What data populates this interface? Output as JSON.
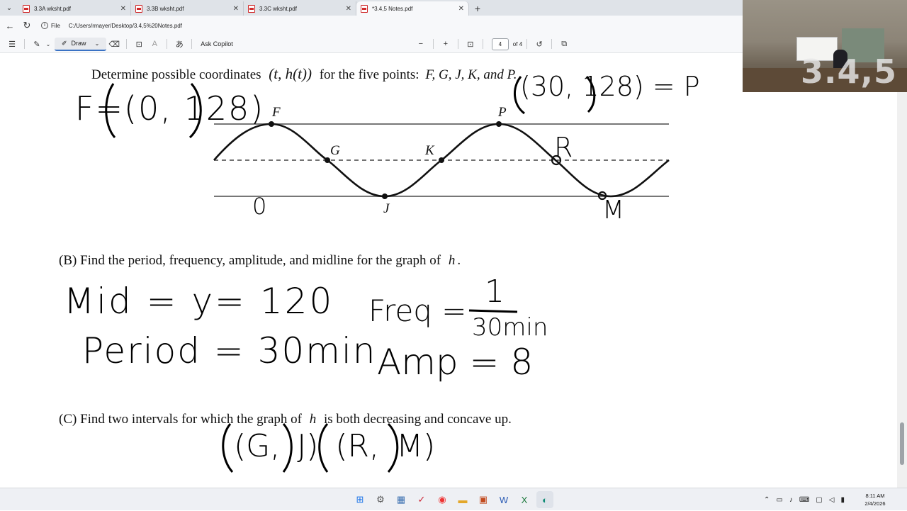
{
  "browser": {
    "tabs": [
      {
        "label": "3.3A wksht.pdf",
        "active": false
      },
      {
        "label": "3.3B wksht.pdf",
        "active": false
      },
      {
        "label": "3.3C wksht.pdf",
        "active": false
      },
      {
        "label": "*3.4,5 Notes.pdf",
        "active": true
      }
    ],
    "new_tab": "+",
    "address": {
      "scheme_label": "File",
      "url": "C:/Users/rmayer/Desktop/3.4,5%20Notes.pdf"
    }
  },
  "pdf_toolbar": {
    "draw_label": "Draw",
    "copilot_label": "Ask Copilot",
    "zoom_out": "−",
    "zoom_in": "+",
    "current_page": "4",
    "page_total": "of 4"
  },
  "document": {
    "question_a": "Determine possible coordinates",
    "question_a_math": "(t, h(t))",
    "question_a_rest": "for the five points:",
    "question_a_points": "F, G, J, K, and P.",
    "graph_labels": {
      "F": "F",
      "G": "G",
      "J": "J",
      "K": "K",
      "P": "P"
    },
    "question_b": "(B)  Find the period, frequency, amplitude, and midline for the graph of",
    "question_b_var": "h",
    "question_b_end": ".",
    "question_c": "(C)  Find two intervals for which the graph of",
    "question_c_var": "h",
    "question_c_end": "is both decreasing and concave up.",
    "handwriting": {
      "f_coord": "F=(0, 128)",
      "p_coord": "(30, 128) = P",
      "zero": "0",
      "r_label": "R",
      "m_label": "M",
      "mid": "Mid  =   y= 120",
      "period": "Period =  30min",
      "freq": "Freq =",
      "freq_num": "1",
      "freq_den": "30min",
      "amp": "Amp = 8",
      "intervals": "(G, J)   (R, M)"
    }
  },
  "webcam": {
    "overlay_text": "3.4,5"
  },
  "system": {
    "time": "8:11 AM",
    "date": "2/4/2026"
  }
}
